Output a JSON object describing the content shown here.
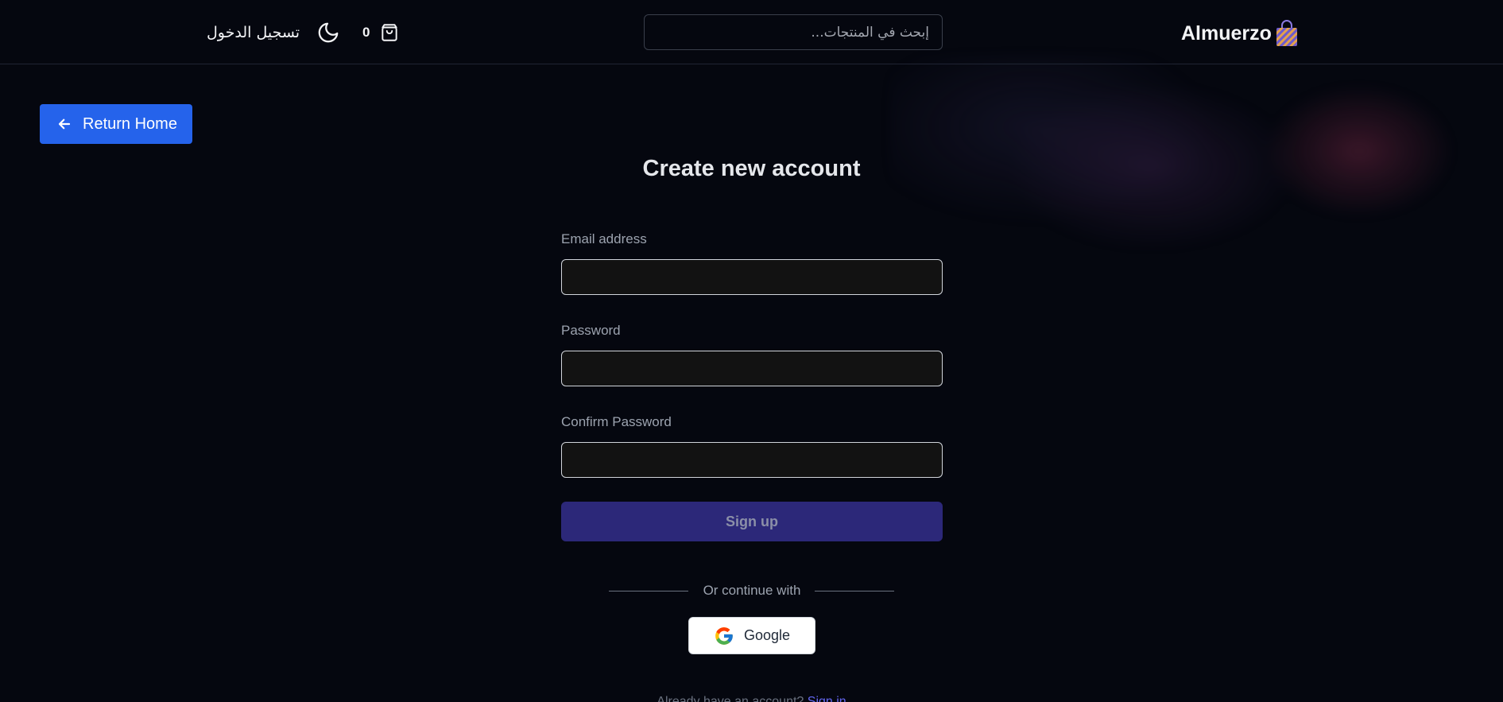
{
  "header": {
    "brand": "Almuerzo",
    "search_placeholder": "إبحث في المنتجات...",
    "cart_count": "0",
    "login_label": "تسجيل الدخول"
  },
  "nav": {
    "return_home_label": "Return Home"
  },
  "form": {
    "title": "Create new account",
    "email_label": "Email address",
    "password_label": "Password",
    "confirm_label": "Confirm Password",
    "submit_label": "Sign up",
    "divider_text": "Or continue with",
    "google_label": "Google"
  },
  "footer": {
    "prompt": "Already have an account?",
    "link": "Sign in"
  },
  "colors": {
    "background": "#05070f",
    "primary": "#2563eb",
    "submit": "#2c2879",
    "accent": "#6366f1"
  },
  "icons": [
    "shopping-bag-icon",
    "cart-icon",
    "moon-icon",
    "arrow-left-icon",
    "google-icon"
  ]
}
